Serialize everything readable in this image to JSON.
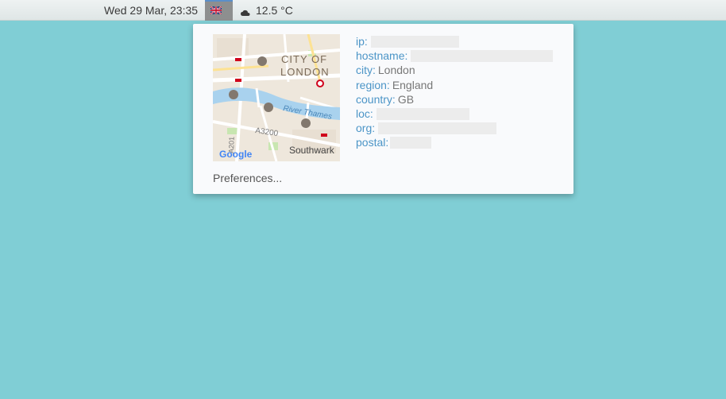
{
  "topbar": {
    "datetime": "Wed 29 Mar, 23:35",
    "flag_icon": "uk-flag-icon",
    "weather_icon": "moon-cloud-icon",
    "temperature": "12.5 °C"
  },
  "popup": {
    "map": {
      "labels": {
        "city": "CITY OF",
        "city2": "LONDON",
        "river": "River Thames",
        "road": "A3200",
        "road2": "A201",
        "district": "Southwark",
        "logo": "Google"
      }
    },
    "fields": [
      {
        "key": "ip:",
        "value": ""
      },
      {
        "key": "hostname:",
        "value": ""
      },
      {
        "key": "city:",
        "value": "London"
      },
      {
        "key": "region:",
        "value": "England"
      },
      {
        "key": "country:",
        "value": "GB"
      },
      {
        "key": "loc:",
        "value": ""
      },
      {
        "key": "org:",
        "value": ""
      },
      {
        "key": "postal:",
        "value": ""
      }
    ],
    "preferences_label": "Preferences..."
  },
  "colors": {
    "desktop_bg": "#80ced5",
    "key_color": "#4c95c7"
  }
}
